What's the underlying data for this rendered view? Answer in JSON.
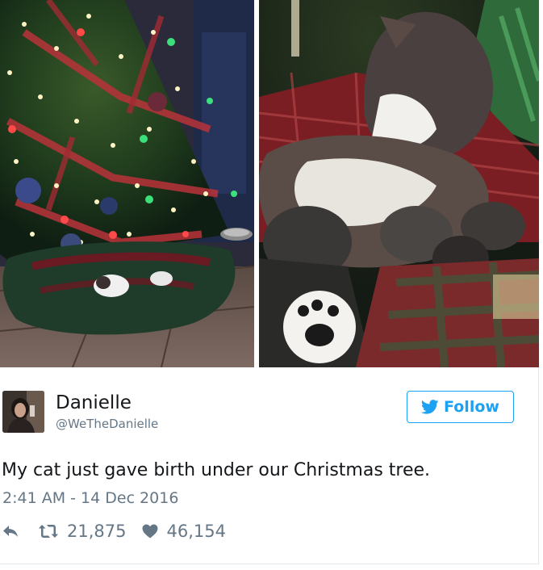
{
  "tweet": {
    "author": {
      "name": "Danielle",
      "handle": "@WeTheDanielle",
      "avatar_icon": "profile-photo"
    },
    "follow_label": "Follow",
    "text": "My cat just gave birth under our Christmas tree.",
    "timestamp": "2:41 AM - 14 Dec 2016",
    "actions": {
      "reply_icon": "reply-icon",
      "retweet_count": "21,875",
      "like_count": "46,154"
    },
    "colors": {
      "accent": "#1da1f2",
      "secondary_text": "#657786",
      "primary_text": "#14171a"
    },
    "media": [
      {
        "name": "christmas-tree-photo"
      },
      {
        "name": "cat-with-kittens-photo"
      }
    ]
  }
}
